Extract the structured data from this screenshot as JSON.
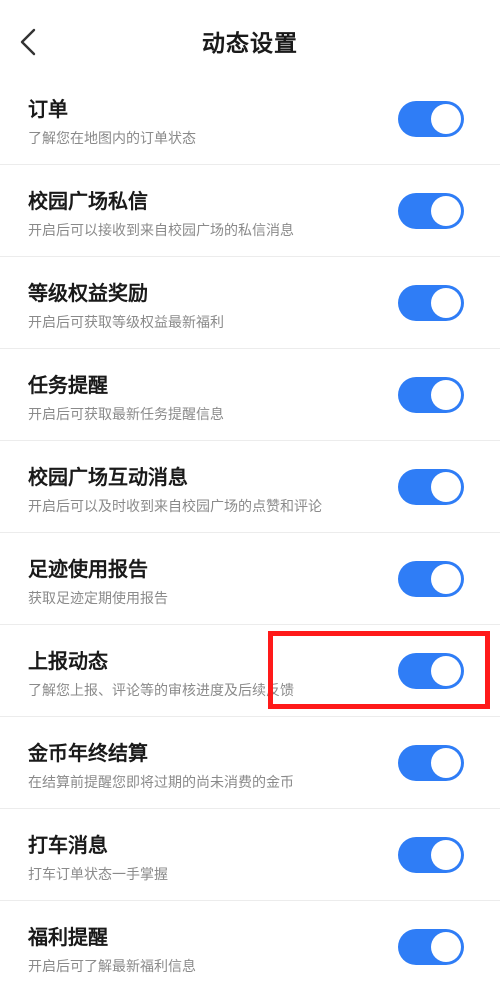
{
  "header": {
    "title": "动态设置"
  },
  "settings": [
    {
      "title": "订单",
      "desc": "了解您在地图内的订单状态",
      "enabled": true
    },
    {
      "title": "校园广场私信",
      "desc": "开启后可以接收到来自校园广场的私信消息",
      "enabled": true
    },
    {
      "title": "等级权益奖励",
      "desc": "开启后可获取等级权益最新福利",
      "enabled": true
    },
    {
      "title": "任务提醒",
      "desc": "开启后可获取最新任务提醒信息",
      "enabled": true
    },
    {
      "title": "校园广场互动消息",
      "desc": "开启后可以及时收到来自校园广场的点赞和评论",
      "enabled": true
    },
    {
      "title": "足迹使用报告",
      "desc": "获取足迹定期使用报告",
      "enabled": true
    },
    {
      "title": "上报动态",
      "desc": "了解您上报、评论等的审核进度及后续反馈",
      "enabled": true
    },
    {
      "title": "金币年终结算",
      "desc": "在结算前提醒您即将过期的尚未消费的金币",
      "enabled": true
    },
    {
      "title": "打车消息",
      "desc": "打车订单状态一手掌握",
      "enabled": true
    },
    {
      "title": "福利提醒",
      "desc": "开启后可了解最新福利信息",
      "enabled": true
    }
  ],
  "colors": {
    "toggle_on": "#2f7df6",
    "highlight": "#ff1a1a"
  },
  "icons": {
    "back": "chevron-left-icon"
  }
}
